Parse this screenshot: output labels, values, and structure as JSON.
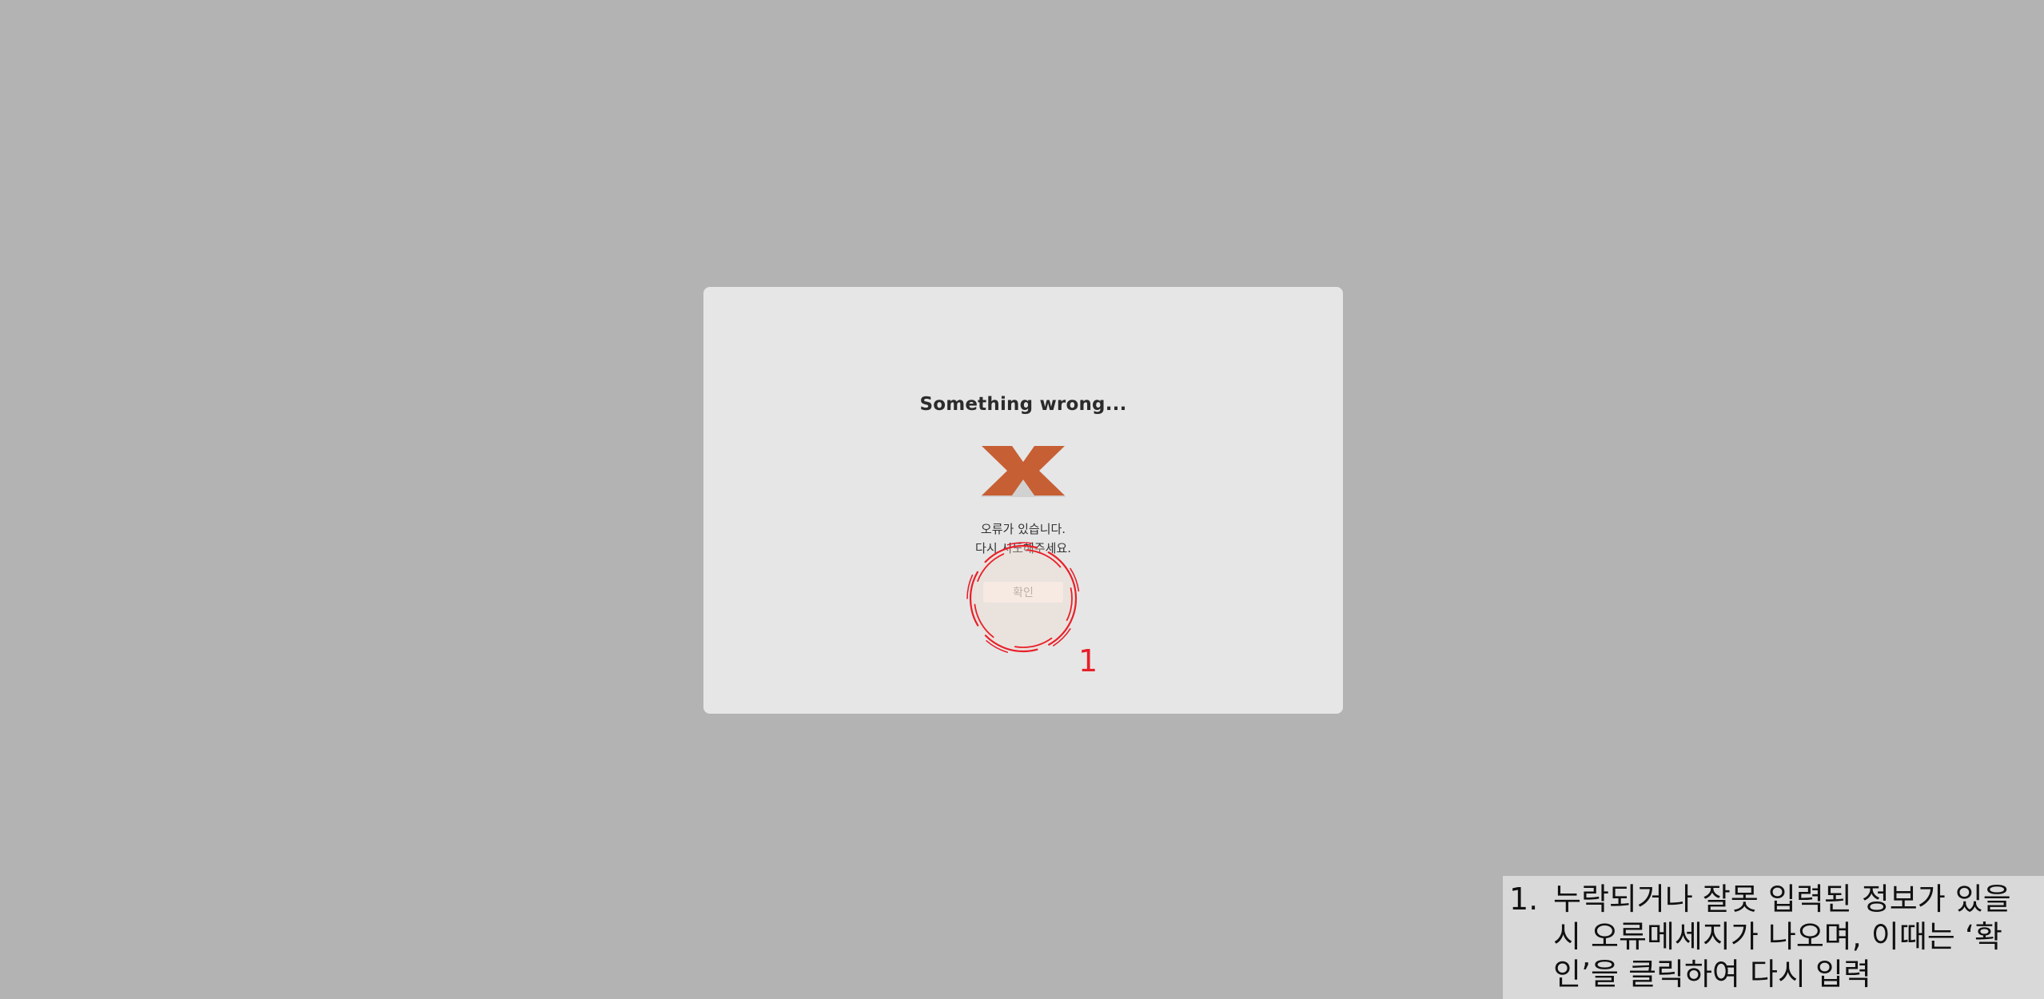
{
  "dialog": {
    "title": "Something wrong...",
    "icon": "error-x-icon",
    "icon_color": "#c75f35",
    "message_lines": [
      "오류가 있습니다.",
      "다시 시도해주세요."
    ],
    "confirm_label": "확인"
  },
  "annotation": {
    "color": "#e8202a",
    "step_number": "1"
  },
  "note": {
    "number": "1.",
    "lines": [
      "누락되거나 잘못 입력된 정보가 있을",
      "시 오류메세지가 나오며, 이때는 ‘확",
      "인’을 클릭하여 다시 입력"
    ]
  }
}
